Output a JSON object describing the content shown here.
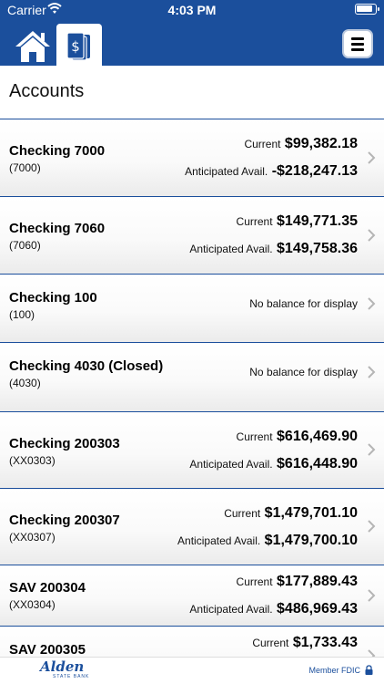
{
  "status_bar": {
    "carrier": "Carrier",
    "time": "4:03 PM"
  },
  "nav": {
    "home_icon": "home-icon",
    "accounts_icon": "dollar-cards-icon",
    "menu_icon": "hamburger-menu-icon"
  },
  "page": {
    "title": "Accounts"
  },
  "accounts": [
    {
      "name": "Checking 7000",
      "number": "(7000)",
      "current_label": "Current",
      "current": "$99,382.18",
      "anticipated_label": "Anticipated Avail.",
      "anticipated": "-$218,247.13"
    },
    {
      "name": "Checking 7060",
      "number": "(7060)",
      "current_label": "Current",
      "current": "$149,771.35",
      "anticipated_label": "Anticipated Avail.",
      "anticipated": "$149,758.36"
    },
    {
      "name": "Checking 100",
      "number": "(100)",
      "no_balance": "No balance for display"
    },
    {
      "name": "Checking 4030 (Closed)",
      "number": "(4030)",
      "no_balance": "No balance for display"
    },
    {
      "name": "Checking 200303",
      "number": "(XX0303)",
      "current_label": "Current",
      "current": "$616,469.90",
      "anticipated_label": "Anticipated Avail.",
      "anticipated": "$616,448.90"
    },
    {
      "name": "Checking 200307",
      "number": "(XX0307)",
      "current_label": "Current",
      "current": "$1,479,701.10",
      "anticipated_label": "Anticipated Avail.",
      "anticipated": "$1,479,700.10"
    },
    {
      "name": "SAV 200304",
      "number": "(XX0304)",
      "current_label": "Current",
      "current": "$177,889.43",
      "anticipated_label": "Anticipated Avail.",
      "anticipated": "$486,969.43"
    },
    {
      "name": "SAV 200305",
      "current_label": "Current",
      "current": "$1,733.43"
    }
  ],
  "footer": {
    "logo_word": "Alden",
    "logo_sub": "STATE BANK",
    "fdic": "Member FDIC",
    "lock_icon": "lock-icon"
  },
  "colors": {
    "brand_blue": "#1b4f9c",
    "row_separator": "#1b4f9c"
  }
}
